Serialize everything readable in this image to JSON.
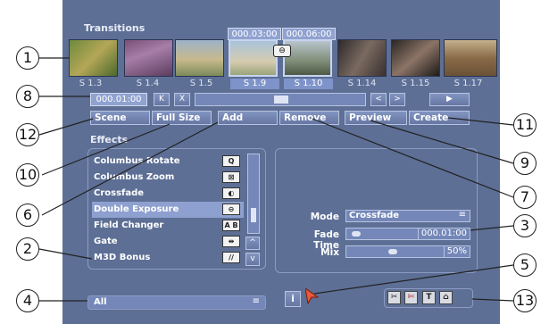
{
  "transitions": {
    "title": "Transitions",
    "timecode_start": "000.03:00",
    "timecode_end": "000.06:00",
    "scenes": [
      "S 1.3",
      "S 1.4",
      "S 1.5",
      "S 1.9",
      "S 1.10",
      "S 1.14",
      "S 1.15",
      "S 1.17"
    ],
    "selected_scenes": [
      3,
      4
    ]
  },
  "controls": {
    "timecode": "000.01:00",
    "btn_k": "K",
    "btn_x": "X",
    "btn_prev": "<",
    "btn_next": ">",
    "btn_play": "▶"
  },
  "buttons": {
    "scene": "Scene",
    "full_size": "Full Size",
    "add": "Add",
    "remove": "Remove",
    "preview": "Preview",
    "create": "Create"
  },
  "effects": {
    "title": "Effects",
    "items": [
      {
        "label": "Columbus Rotate",
        "icon": "Q"
      },
      {
        "label": "Columbus Zoom",
        "icon": "⊠"
      },
      {
        "label": "Crossfade",
        "icon": "◐"
      },
      {
        "label": "Double Exposure",
        "icon": "⊖"
      },
      {
        "label": "Field Changer",
        "icon": "A B"
      },
      {
        "label": "Gate",
        "icon": "⇹"
      },
      {
        "label": "M3D Bonus",
        "icon": "//"
      }
    ],
    "selected_index": 3,
    "filter": "All"
  },
  "params": {
    "mode_label": "Mode",
    "mode_value": "Crossfade",
    "fade_label": "Fade Time",
    "fade_value": "000.01:00",
    "mix_label": "Mix",
    "mix_value": "50%",
    "mix_level": 0.5
  },
  "info_label": "i",
  "toolbar": [
    "scissors",
    "split",
    "T",
    "home"
  ],
  "callouts": [
    "1",
    "2",
    "3",
    "4",
    "5",
    "6",
    "7",
    "8",
    "9",
    "10",
    "11",
    "12",
    "13"
  ]
}
